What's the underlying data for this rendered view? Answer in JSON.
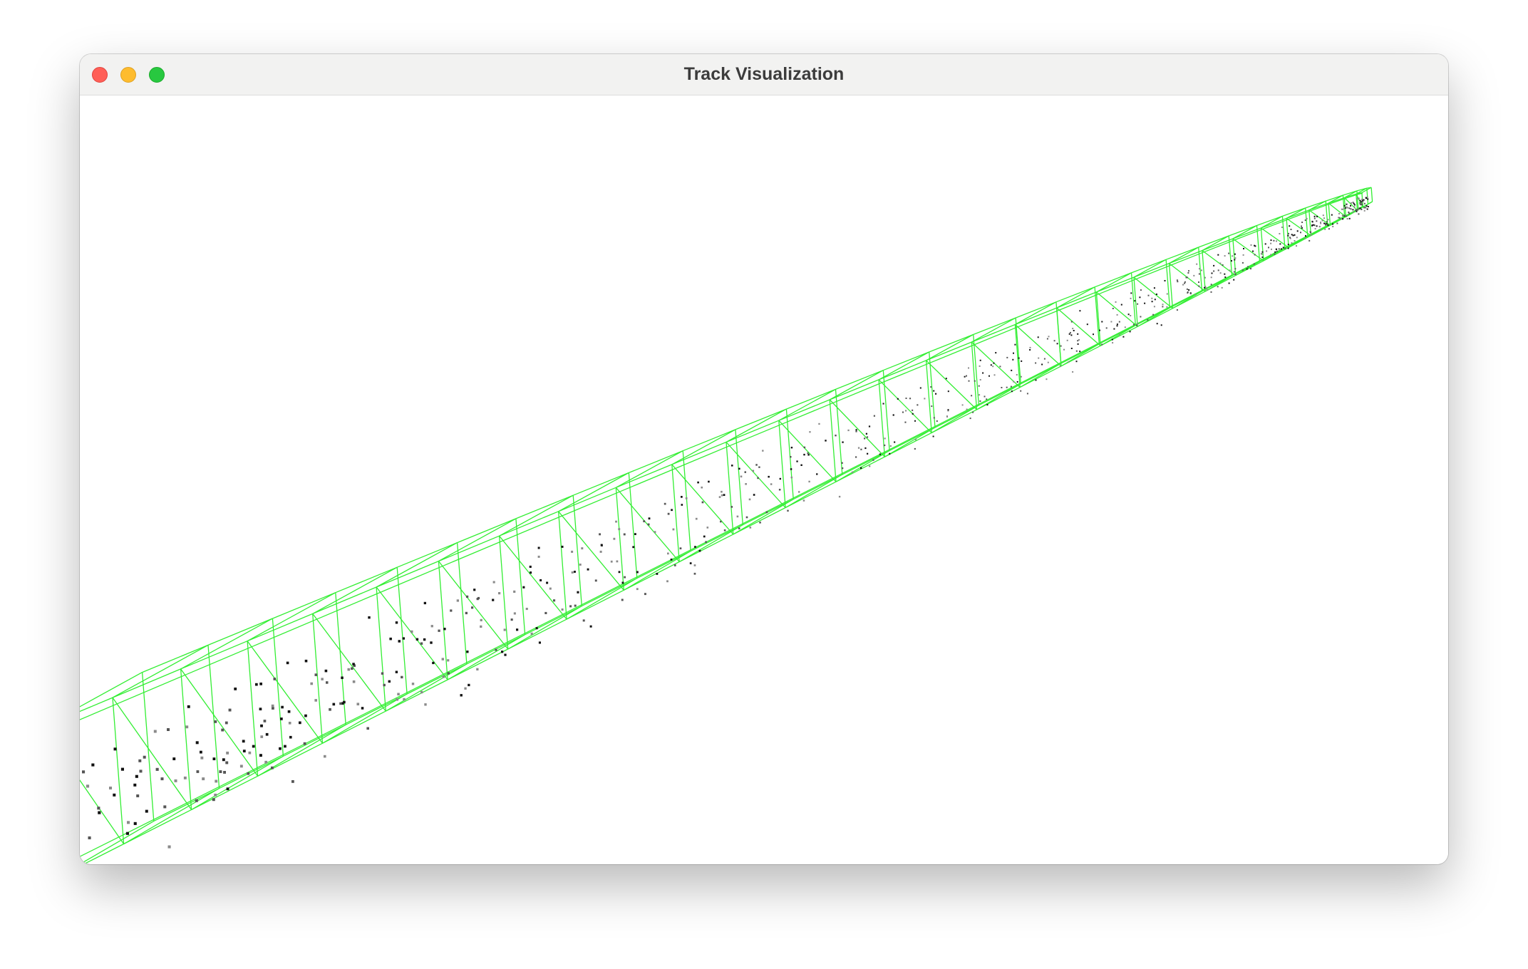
{
  "window": {
    "title": "Track Visualization"
  },
  "scene": {
    "wireframe_color": "#33ee33",
    "point_colors": [
      "#111111",
      "#555555",
      "#8a8a8a"
    ],
    "box_count": 30
  }
}
